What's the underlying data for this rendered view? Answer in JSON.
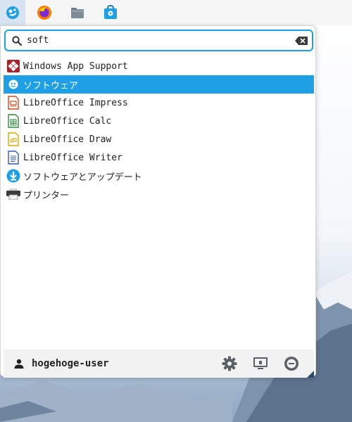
{
  "panel": {
    "launcher_icon": "app-launcher-icon",
    "apps": [
      {
        "name": "firefox-icon"
      },
      {
        "name": "file-manager-icon"
      },
      {
        "name": "software-store-icon"
      }
    ]
  },
  "search": {
    "value": "soft",
    "placeholder": ""
  },
  "results": [
    {
      "label": "Windows App Support",
      "icon": "windows-app-support-icon",
      "selected": false
    },
    {
      "label": "ソフトウェア",
      "icon": "software-icon",
      "selected": true
    },
    {
      "label": "LibreOffice Impress",
      "icon": "libreoffice-impress-icon",
      "selected": false
    },
    {
      "label": "LibreOffice Calc",
      "icon": "libreoffice-calc-icon",
      "selected": false
    },
    {
      "label": "LibreOffice Draw",
      "icon": "libreoffice-draw-icon",
      "selected": false
    },
    {
      "label": "LibreOffice Writer",
      "icon": "libreoffice-writer-icon",
      "selected": false
    },
    {
      "label": "ソフトウェアとアップデート",
      "icon": "software-updates-icon",
      "selected": false
    },
    {
      "label": "プリンター",
      "icon": "printer-icon",
      "selected": false
    }
  ],
  "footer": {
    "user_name": "hogehoge-user",
    "buttons": [
      "settings-icon",
      "lock-screen-icon",
      "logout-icon"
    ]
  },
  "colors": {
    "accent": "#1fa0e6",
    "panel_bg": "#f6f6f6",
    "footer_bg": "#f2f2f2"
  }
}
